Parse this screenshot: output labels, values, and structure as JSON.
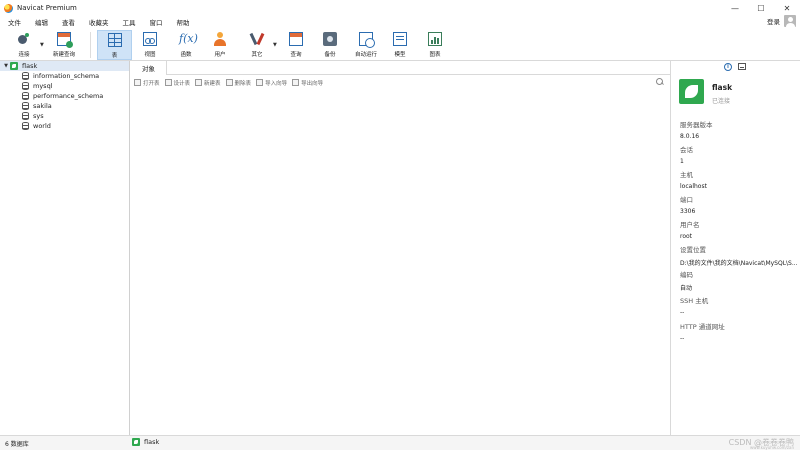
{
  "app": {
    "title": "Navicat Premium"
  },
  "window_controls": {
    "minimize": "—",
    "maximize": "☐",
    "close": "✕"
  },
  "menu": {
    "items": [
      "文件",
      "编辑",
      "查看",
      "收藏夹",
      "工具",
      "窗口",
      "帮助"
    ]
  },
  "account": {
    "login_label": "登录"
  },
  "toolbar": {
    "buttons": [
      {
        "label": "连接",
        "icon": "connection-icon"
      },
      {
        "label": "新建查询",
        "icon": "new-query-icon"
      },
      {
        "label": "表",
        "icon": "table-icon",
        "active": true
      },
      {
        "label": "视图",
        "icon": "view-icon"
      },
      {
        "label": "函数",
        "icon": "function-icon",
        "glyph": "f(x)"
      },
      {
        "label": "用户",
        "icon": "user-icon"
      },
      {
        "label": "其它",
        "icon": "tools-icon"
      },
      {
        "label": "查询",
        "icon": "query-icon"
      },
      {
        "label": "备份",
        "icon": "backup-icon"
      },
      {
        "label": "自动运行",
        "icon": "schedule-icon"
      },
      {
        "label": "模型",
        "icon": "model-icon"
      },
      {
        "label": "图表",
        "icon": "chart-icon"
      }
    ],
    "dropdown_arrow": "▼"
  },
  "navigator": {
    "connection": {
      "name": "flask",
      "expanded_glyph": "▼"
    },
    "databases": [
      "information_schema",
      "mysql",
      "performance_schema",
      "sakila",
      "sys",
      "world"
    ]
  },
  "main": {
    "tab_label": "对象",
    "object_toolbar": [
      "打开表",
      "设计表",
      "新建表",
      "删除表",
      "导入向导",
      "导出向导"
    ]
  },
  "info_panel": {
    "connection_name": "flask",
    "status": "已连接",
    "fields": [
      {
        "key": "服务器版本",
        "value": "8.0.16"
      },
      {
        "key": "会话",
        "value": "1"
      },
      {
        "key": "主机",
        "value": "localhost"
      },
      {
        "key": "端口",
        "value": "3306"
      },
      {
        "key": "用户名",
        "value": "root"
      },
      {
        "key": "设置位置",
        "value": "D:\\我的文件\\我的文档\\Navicat\\MySQL\\S..."
      },
      {
        "key": "编码",
        "value": "自动"
      },
      {
        "key": "SSH 主机",
        "value": "--"
      },
      {
        "key": "HTTP 通道网址",
        "value": "--"
      }
    ],
    "info_glyph": "i"
  },
  "statusbar": {
    "db_count": "6 数据库",
    "connection": "flask",
    "watermark": "CSDN @卷卷卷鸭",
    "watermark_sub": "www.kuyuhw.com/zan"
  },
  "colors": {
    "accent": "#2b6cb0",
    "connection_green": "#2fa84f",
    "selection": "#cfe3f7"
  }
}
